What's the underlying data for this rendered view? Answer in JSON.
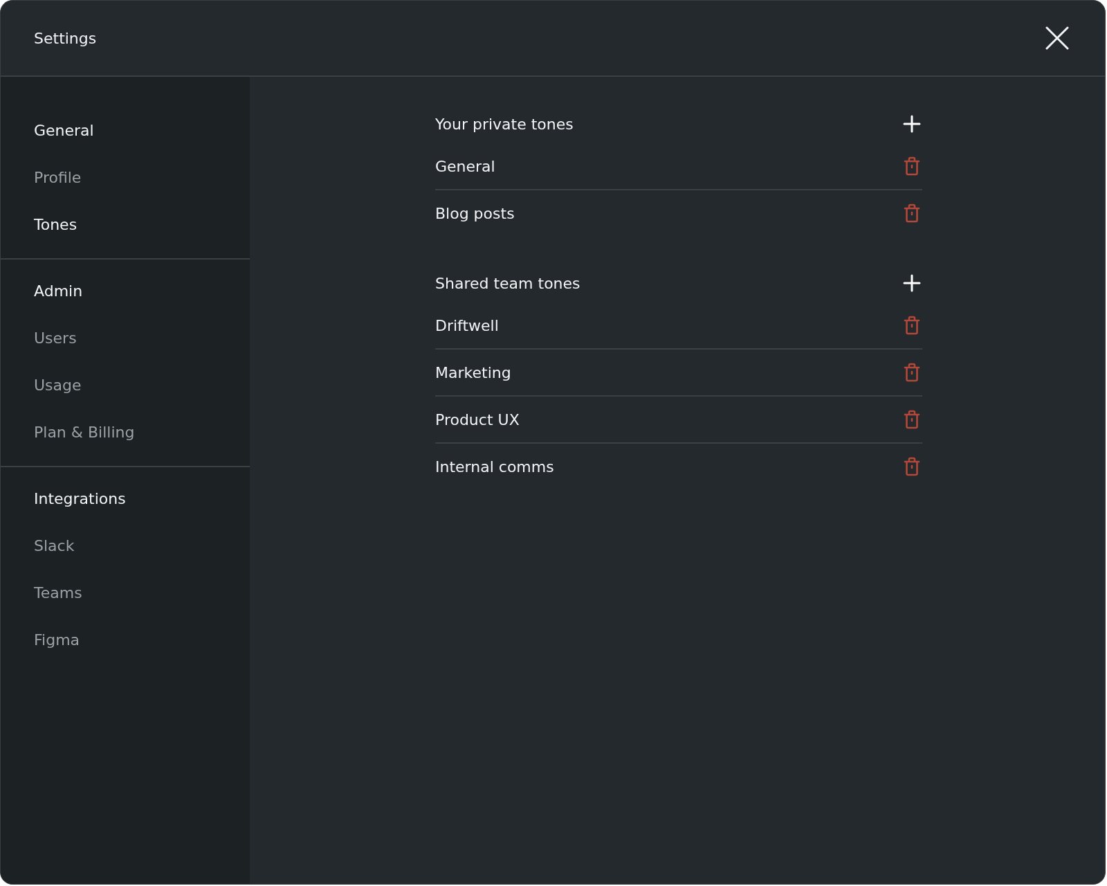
{
  "window": {
    "title": "Settings"
  },
  "sidebar": {
    "sections": [
      {
        "header": "General",
        "items": [
          {
            "label": "Profile",
            "selected": false
          },
          {
            "label": "Tones",
            "selected": true
          }
        ]
      },
      {
        "header": "Admin",
        "items": [
          {
            "label": "Users",
            "selected": false
          },
          {
            "label": "Usage",
            "selected": false
          },
          {
            "label": "Plan & Billing",
            "selected": false
          }
        ]
      },
      {
        "header": "Integrations",
        "items": [
          {
            "label": "Slack",
            "selected": false
          },
          {
            "label": "Teams",
            "selected": false
          },
          {
            "label": "Figma",
            "selected": false
          }
        ]
      }
    ]
  },
  "tone_groups": [
    {
      "title": "Your private tones",
      "tones": [
        "General",
        "Blog posts"
      ]
    },
    {
      "title": "Shared team tones",
      "tones": [
        "Driftwell",
        "Marketing",
        "Product UX",
        "Internal comms"
      ]
    }
  ]
}
